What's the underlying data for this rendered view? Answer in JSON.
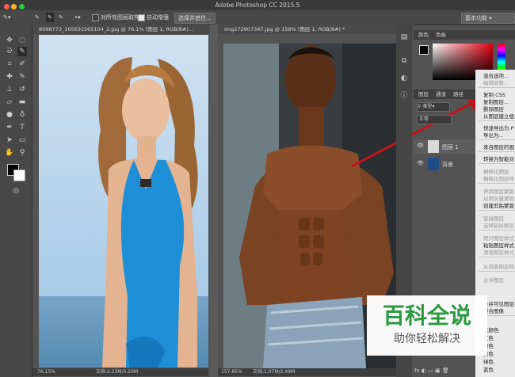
{
  "app": {
    "title": "Adobe Photoshop CC 2015.5"
  },
  "options": {
    "sample_all_layers": "对所有图层取样",
    "auto_enhance": "自动增强",
    "select_mask_button": "选择并遮住...",
    "workspace": "基本功能"
  },
  "documents": [
    {
      "tab": "8098773_165631565104_2.jpg @ 76.1% (图层 1, RGB/8#)...",
      "zoom": "76.15%",
      "doc_size": "文档:2.23M/5.20M"
    },
    {
      "tab": "img272907347.jpg @ 158% (图层 1, RGB/8#) *",
      "zoom": "157.85%",
      "doc_size": "文档:1.07M/2.49M"
    }
  ],
  "panels": {
    "color_tabs": [
      "颜色",
      "色板"
    ],
    "layer_tabs": [
      "图层",
      "通道",
      "路径"
    ],
    "kind_filter": "类型",
    "blend_mode": "正常",
    "layers": [
      "图层 1",
      "背景"
    ]
  },
  "context_menu": {
    "items": [
      {
        "label": "混合选项...",
        "disabled": false
      },
      {
        "label": "编辑调整...",
        "disabled": true
      },
      {
        "label": "复制 CSS",
        "disabled": false
      },
      {
        "label": "复制图层...",
        "disabled": false
      },
      {
        "label": "删除图层",
        "disabled": false
      },
      {
        "label": "从图层建立组...",
        "disabled": false
      },
      {
        "label": "快速导出为 P",
        "disabled": false
      },
      {
        "label": "导出为...",
        "disabled": false
      },
      {
        "label": "来自图层的画",
        "disabled": false
      },
      {
        "label": "转换为智能对",
        "disabled": false
      },
      {
        "label": "栅格化图层",
        "disabled": true
      },
      {
        "label": "栅格化图层样",
        "disabled": true
      },
      {
        "label": "停用图层蒙版",
        "disabled": true
      },
      {
        "label": "启用矢量蒙版",
        "disabled": true
      },
      {
        "label": "创建剪贴蒙版",
        "disabled": false
      },
      {
        "label": "链接图层",
        "disabled": true
      },
      {
        "label": "选择链接图层",
        "disabled": true
      },
      {
        "label": "拷贝图层样式",
        "disabled": true
      },
      {
        "label": "粘贴图层样式",
        "disabled": false
      },
      {
        "label": "清除图层样式",
        "disabled": true
      },
      {
        "label": "从隔离图层释",
        "disabled": true
      },
      {
        "label": "合并图层",
        "disabled": true
      },
      {
        "label": "合并可见图层",
        "disabled": false
      },
      {
        "label": "拼合图像",
        "disabled": false
      },
      {
        "label": "无颜色",
        "disabled": false
      },
      {
        "label": "红色",
        "disabled": false
      },
      {
        "label": "橙色",
        "disabled": false
      },
      {
        "label": "黄色",
        "disabled": false
      },
      {
        "label": "绿色",
        "disabled": false
      },
      {
        "label": "蓝色",
        "disabled": false
      }
    ]
  },
  "watermark": {
    "title": "百科全说",
    "subtitle": "助你轻松解决"
  },
  "colors": {
    "accent_arrow": "#c0151d",
    "watermark_green": "#2b9a3f"
  }
}
